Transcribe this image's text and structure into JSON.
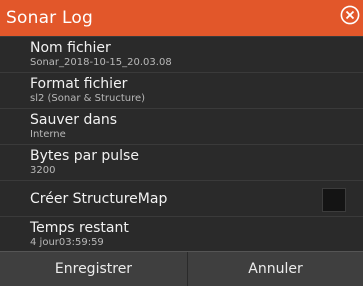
{
  "dialog": {
    "title": "Sonar Log",
    "close_icon": "close-circle-icon"
  },
  "rows": [
    {
      "label": "Nom fichier",
      "value": "Sonar_2018-10-15_20.03.08"
    },
    {
      "label": "Format fichier",
      "value": "sl2 (Sonar & Structure)"
    },
    {
      "label": "Sauver dans",
      "value": "Interne"
    },
    {
      "label": "Bytes par pulse",
      "value": "3200"
    },
    {
      "label": "Créer StructureMap",
      "checked": false
    },
    {
      "label": "Temps restant",
      "value": "4 jour03:59:59"
    }
  ],
  "footer": {
    "save_label": "Enregistrer",
    "cancel_label": "Annuler"
  },
  "colors": {
    "title_bar": "#e2572a",
    "background": "#262626",
    "footer": "#3f3f3f"
  }
}
